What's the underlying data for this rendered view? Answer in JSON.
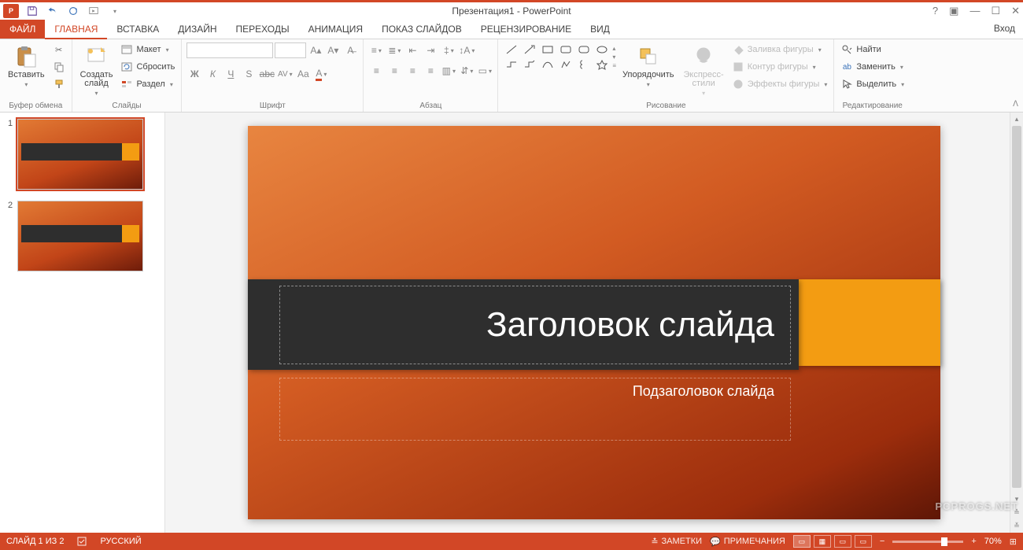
{
  "app_title": "Презентация1 - PowerPoint",
  "signin": "Вход",
  "tabs": {
    "file": "ФАЙЛ",
    "home": "ГЛАВНАЯ",
    "insert": "ВСТАВКА",
    "design": "ДИЗАЙН",
    "transitions": "ПЕРЕХОДЫ",
    "animation": "АНИМАЦИЯ",
    "slideshow": "ПОКАЗ СЛАЙДОВ",
    "review": "РЕЦЕНЗИРОВАНИЕ",
    "view": "ВИД"
  },
  "ribbon": {
    "clipboard": {
      "paste": "Вставить",
      "label": "Буфер обмена"
    },
    "slides": {
      "new_slide": "Создать\nслайд",
      "layout": "Макет",
      "reset": "Сбросить",
      "section": "Раздел",
      "label": "Слайды"
    },
    "font": {
      "label": "Шрифт"
    },
    "paragraph": {
      "label": "Абзац"
    },
    "drawing": {
      "arrange": "Упорядочить",
      "quick_styles": "Экспресс-\nстили",
      "shape_fill": "Заливка фигуры",
      "shape_outline": "Контур фигуры",
      "shape_effects": "Эффекты фигуры",
      "label": "Рисование"
    },
    "editing": {
      "find": "Найти",
      "replace": "Заменить",
      "select": "Выделить",
      "label": "Редактирование"
    }
  },
  "thumbs": {
    "n1": "1",
    "n2": "2"
  },
  "slide": {
    "title_placeholder": "Заголовок слайда",
    "subtitle_placeholder": "Подзаголовок слайда"
  },
  "status": {
    "slide_counter": "СЛАЙД 1 ИЗ 2",
    "language": "РУССКИЙ",
    "notes": "ЗАМЕТКИ",
    "comments": "ПРИМЕЧАНИЯ",
    "zoom": "70%"
  },
  "watermark": "PCPROGS.NET"
}
